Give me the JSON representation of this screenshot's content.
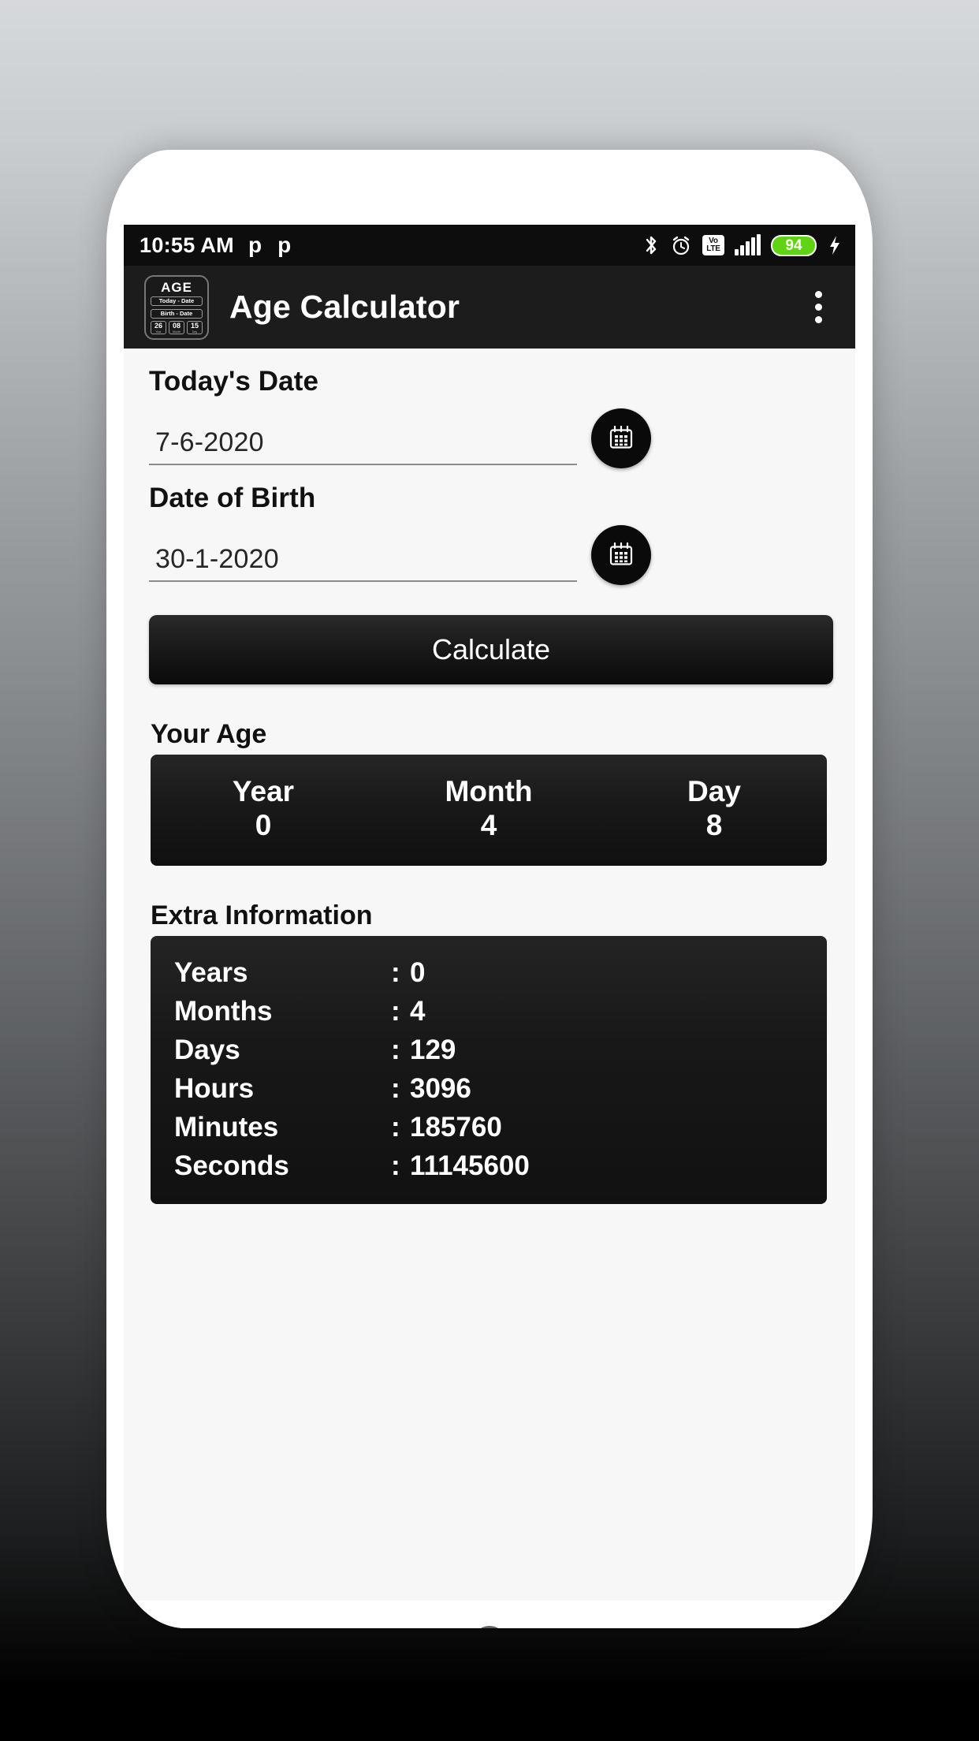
{
  "status_bar": {
    "time": "10:55 AM",
    "left_icons": [
      "p-icon",
      "p-icon"
    ],
    "right_icons": [
      "bluetooth-icon",
      "alarm-icon",
      "volte-icon",
      "signal-icon",
      "battery-icon",
      "charging-bolt-icon"
    ],
    "volte_top": "Vo",
    "volte_bottom": "LTE",
    "battery_level": "94"
  },
  "app_bar": {
    "title": "Age Calculator",
    "icon": {
      "name": "age-calculator-app-icon",
      "title": "AGE",
      "row1": "Today - Date",
      "row2": "Birth - Date",
      "boxes": [
        {
          "value": "26",
          "label": "Year"
        },
        {
          "value": "08",
          "label": "Month"
        },
        {
          "value": "15",
          "label": "Day"
        }
      ]
    },
    "overflow_icon": "more-vertical-icon"
  },
  "form": {
    "today_label": "Today's Date",
    "today_value": "7-6-2020",
    "today_placeholder": "Today's Date",
    "birth_label": "Date of Birth",
    "birth_value": "30-1-2020",
    "birth_placeholder": "Date of Birth",
    "calendar_icon": "calendar-icon",
    "calculate_label": "Calculate"
  },
  "your_age": {
    "section_label": "Your Age",
    "columns": [
      {
        "label": "Year",
        "value": "0"
      },
      {
        "label": "Month",
        "value": "4"
      },
      {
        "label": "Day",
        "value": "8"
      }
    ]
  },
  "extra_information": {
    "section_label": "Extra Information",
    "separator": ":",
    "rows": [
      {
        "key": "Years",
        "value": "0"
      },
      {
        "key": "Months",
        "value": "4"
      },
      {
        "key": "Days",
        "value": "129"
      },
      {
        "key": "Hours",
        "value": "3096"
      },
      {
        "key": "Minutes",
        "value": "185760"
      },
      {
        "key": "Seconds",
        "value": "11145600"
      }
    ]
  },
  "nav_bar": {
    "recents": "recents-square-icon",
    "home": "home-circle-icon",
    "back": "back-triangle-icon"
  },
  "colors": {
    "accent_dark": "#0d0d0d",
    "app_bar": "#1c1c1c",
    "card": "#141414",
    "screen_bg": "#f7f7f7",
    "battery_green": "#5fd314",
    "nav_icon": "#636363"
  }
}
